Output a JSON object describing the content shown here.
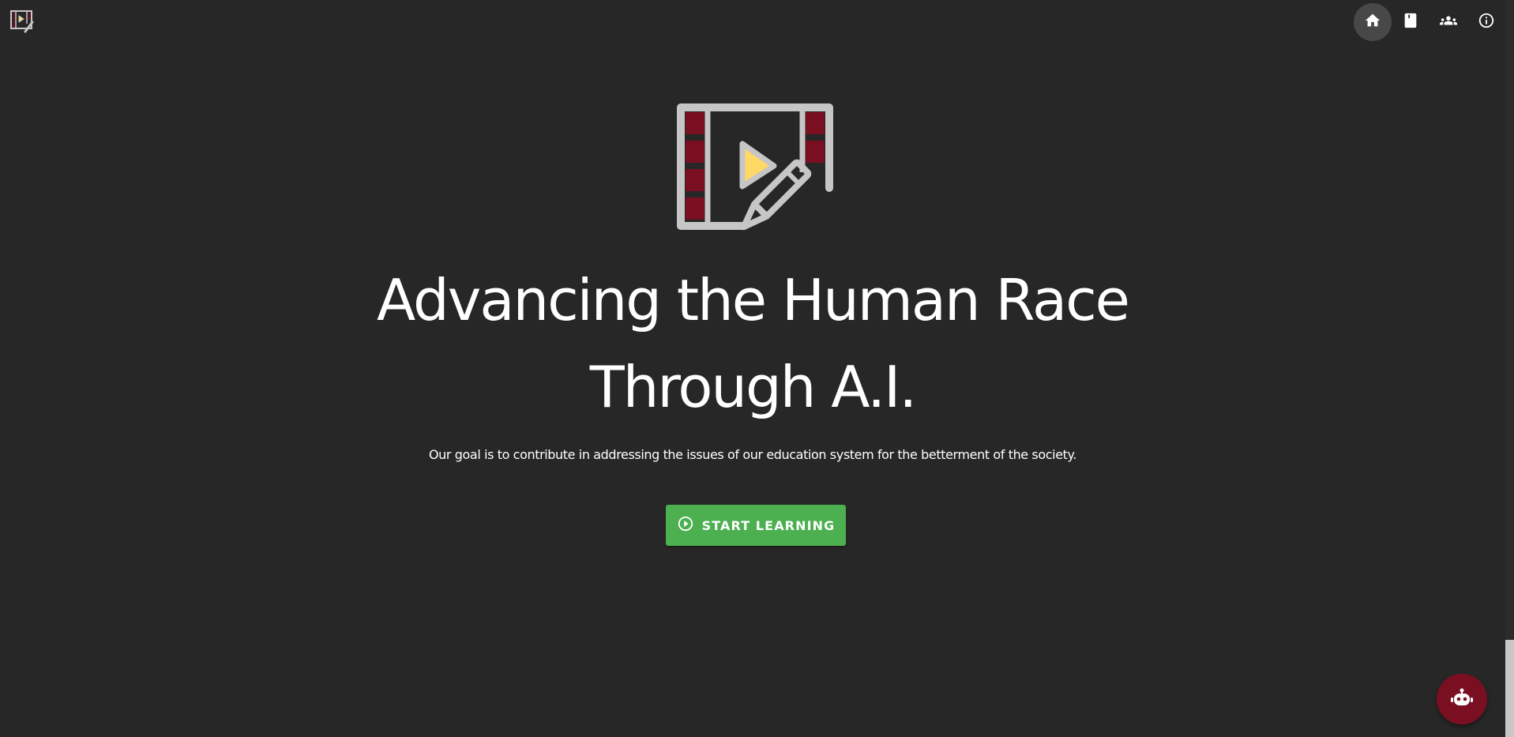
{
  "nav": {
    "items": [
      {
        "name": "home",
        "icon": "home-icon",
        "active": true
      },
      {
        "name": "courses",
        "icon": "book-icon",
        "active": false
      },
      {
        "name": "team",
        "icon": "people-icon",
        "active": false
      },
      {
        "name": "about",
        "icon": "info-icon",
        "active": false
      }
    ]
  },
  "hero": {
    "logo_icon": "film-pencil-play-icon",
    "title": "Advancing the Human Race Through A.I.",
    "subtitle": "Our goal is to contribute in addressing the issues of our education system for the betterment of the society.",
    "cta_label": "START LEARNING",
    "cta_icon": "play-circle-icon"
  },
  "fab": {
    "icon": "robot-icon"
  },
  "colors": {
    "background": "#272727",
    "cta_green": "#4caf50",
    "brand_maroon": "#7a0f22",
    "logo_gray": "#c6c6c6",
    "logo_yellow": "#ffd966",
    "nav_active": "#484848"
  }
}
